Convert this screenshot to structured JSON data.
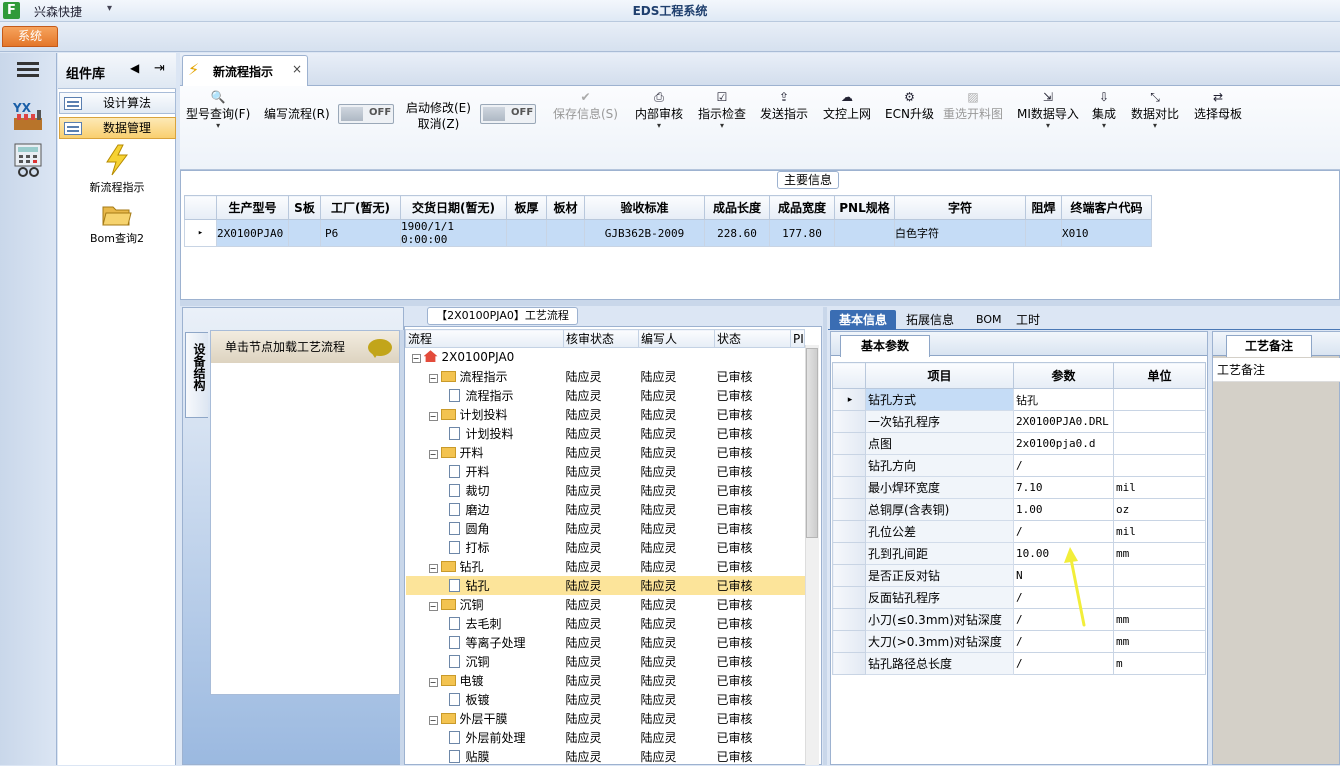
{
  "app": {
    "logo_letter": "F",
    "name": "兴森快捷",
    "qat_glyph": "▾",
    "window_title": "EDS工程系统",
    "menu_tab": "系统"
  },
  "component_library": {
    "title": "组件库",
    "prev_glyph": "◀",
    "pin_glyph": "⇥",
    "nav": [
      {
        "label": "设计算法"
      },
      {
        "label": "数据管理"
      }
    ],
    "tiles": [
      {
        "label": "新流程指示",
        "icon": "lightning-icon"
      },
      {
        "label": "Bom查询2",
        "icon": "folder-open-icon"
      }
    ]
  },
  "doc_tab": {
    "title": "新流程指示",
    "close": "×"
  },
  "toolbar": {
    "items": [
      {
        "label": "型号查询(F)",
        "icon": "🔍",
        "dropdown": "▾"
      },
      {
        "label": "编写流程(R)",
        "icon": "",
        "dropdown": ""
      },
      {
        "label": "启动修改(E)",
        "label2": "取消(Z)",
        "icon": "",
        "dropdown": ""
      },
      {
        "label": "保存信息(S)",
        "icon": "✔",
        "dropdown": ""
      },
      {
        "label": "内部审核",
        "icon": "⎙",
        "dropdown": "▾"
      },
      {
        "label": "指示检查",
        "icon": "☑",
        "dropdown": "▾"
      },
      {
        "label": "发送指示",
        "icon": "⇪",
        "dropdown": ""
      },
      {
        "label": "文控上网",
        "icon": "☁",
        "dropdown": ""
      },
      {
        "label": "ECN升级",
        "icon": "⚙",
        "dropdown": ""
      },
      {
        "label": "重选开料图",
        "icon": "▨",
        "dropdown": ""
      },
      {
        "label": "MI数据导入",
        "icon": "⇲",
        "dropdown": "▾"
      },
      {
        "label": "集成",
        "icon": "⇩",
        "dropdown": "▾"
      },
      {
        "label": "数据对比",
        "icon": "⤡",
        "dropdown": "▾"
      },
      {
        "label": "选择母板",
        "icon": "⇄",
        "dropdown": ""
      }
    ],
    "toggle1": "OFF",
    "toggle2": "OFF"
  },
  "main_info": {
    "title": "主要信息",
    "columns": [
      "生产型号",
      "S板",
      "工厂(暂无)",
      "交货日期(暂无)",
      "板厚",
      "板材",
      "验收标准",
      "成品长度",
      "成品宽度",
      "PNL规格",
      "字符",
      "阻焊",
      "终端客户代码"
    ],
    "row_marker": "▸",
    "rows": [
      [
        "2X0100PJA0",
        "",
        "P6",
        "1900/1/1 0:00:00",
        "",
        "",
        "GJB362B-2009",
        "228.60",
        "177.80",
        "",
        "白色字符",
        "",
        "X010"
      ]
    ]
  },
  "left_pane": {
    "vertical_tab": "设备结构",
    "load_text": "单击节点加载工艺流程"
  },
  "process_tree": {
    "title": "【2X0100PJA0】工艺流程",
    "columns": [
      "流程",
      "核审状态",
      "编写人",
      "状态",
      "PI"
    ],
    "expand_glyph": "−",
    "rows": [
      {
        "level": 0,
        "type": "root",
        "name": "2X0100PJA0",
        "c1": "",
        "c2": "",
        "c3": ""
      },
      {
        "level": 1,
        "type": "folder",
        "name": "流程指示",
        "c1": "陆应灵",
        "c2": "陆应灵",
        "c3": "已审核"
      },
      {
        "level": 2,
        "type": "file",
        "name": "流程指示",
        "c1": "陆应灵",
        "c2": "陆应灵",
        "c3": "已审核"
      },
      {
        "level": 1,
        "type": "folder",
        "name": "计划投料",
        "c1": "陆应灵",
        "c2": "陆应灵",
        "c3": "已审核"
      },
      {
        "level": 2,
        "type": "file",
        "name": "计划投料",
        "c1": "陆应灵",
        "c2": "陆应灵",
        "c3": "已审核"
      },
      {
        "level": 1,
        "type": "folder",
        "name": "开料",
        "c1": "陆应灵",
        "c2": "陆应灵",
        "c3": "已审核"
      },
      {
        "level": 2,
        "type": "file",
        "name": "开料",
        "c1": "陆应灵",
        "c2": "陆应灵",
        "c3": "已审核"
      },
      {
        "level": 2,
        "type": "file",
        "name": "裁切",
        "c1": "陆应灵",
        "c2": "陆应灵",
        "c3": "已审核"
      },
      {
        "level": 2,
        "type": "file",
        "name": "磨边",
        "c1": "陆应灵",
        "c2": "陆应灵",
        "c3": "已审核"
      },
      {
        "level": 2,
        "type": "file",
        "name": "圆角",
        "c1": "陆应灵",
        "c2": "陆应灵",
        "c3": "已审核"
      },
      {
        "level": 2,
        "type": "file",
        "name": "打标",
        "c1": "陆应灵",
        "c2": "陆应灵",
        "c3": "已审核"
      },
      {
        "level": 1,
        "type": "folder",
        "name": "钻孔",
        "c1": "陆应灵",
        "c2": "陆应灵",
        "c3": "已审核"
      },
      {
        "level": 2,
        "type": "file",
        "name": "钻孔",
        "c1": "陆应灵",
        "c2": "陆应灵",
        "c3": "已审核",
        "selected": true
      },
      {
        "level": 1,
        "type": "folder",
        "name": "沉铜",
        "c1": "陆应灵",
        "c2": "陆应灵",
        "c3": "已审核"
      },
      {
        "level": 2,
        "type": "file",
        "name": "去毛刺",
        "c1": "陆应灵",
        "c2": "陆应灵",
        "c3": "已审核"
      },
      {
        "level": 2,
        "type": "file",
        "name": "等离子处理",
        "c1": "陆应灵",
        "c2": "陆应灵",
        "c3": "已审核"
      },
      {
        "level": 2,
        "type": "file",
        "name": "沉铜",
        "c1": "陆应灵",
        "c2": "陆应灵",
        "c3": "已审核"
      },
      {
        "level": 1,
        "type": "folder",
        "name": "电镀",
        "c1": "陆应灵",
        "c2": "陆应灵",
        "c3": "已审核"
      },
      {
        "level": 2,
        "type": "file",
        "name": "板镀",
        "c1": "陆应灵",
        "c2": "陆应灵",
        "c3": "已审核"
      },
      {
        "level": 1,
        "type": "folder",
        "name": "外层干膜",
        "c1": "陆应灵",
        "c2": "陆应灵",
        "c3": "已审核"
      },
      {
        "level": 2,
        "type": "file",
        "name": "外层前处理",
        "c1": "陆应灵",
        "c2": "陆应灵",
        "c3": "已审核"
      },
      {
        "level": 2,
        "type": "file",
        "name": "贴膜",
        "c1": "陆应灵",
        "c2": "陆应灵",
        "c3": "已审核"
      }
    ]
  },
  "detail_tabs": [
    "基本信息",
    "拓展信息",
    "BOM",
    "工时"
  ],
  "base_params": {
    "tab": "基本参数",
    "columns": [
      "项目",
      "参数",
      "单位"
    ],
    "row_marker": "▸",
    "rows": [
      {
        "item": "钻孔方式",
        "value": "钻孔",
        "unit": ""
      },
      {
        "item": "一次钻孔程序",
        "value": "2X0100PJA0.DRL",
        "unit": ""
      },
      {
        "item": "点图",
        "value": "2x0100pja0.d",
        "unit": ""
      },
      {
        "item": "钻孔方向",
        "value": "/",
        "unit": ""
      },
      {
        "item": "最小焊环宽度",
        "value": "7.10",
        "unit": "mil"
      },
      {
        "item": "总铜厚(含表铜)",
        "value": "1.00",
        "unit": "oz"
      },
      {
        "item": "孔位公差",
        "value": "/",
        "unit": "mil"
      },
      {
        "item": "孔到孔间距",
        "value": "10.00",
        "unit": "mm"
      },
      {
        "item": "是否正反对钻",
        "value": "N",
        "unit": ""
      },
      {
        "item": "反面钻孔程序",
        "value": "/",
        "unit": ""
      },
      {
        "item": "小刀(≤0.3mm)对钻深度",
        "value": "/",
        "unit": "mm"
      },
      {
        "item": "大刀(>0.3mm)对钻深度",
        "value": "/",
        "unit": "mm"
      },
      {
        "item": "钻孔路径总长度",
        "value": "/",
        "unit": "m"
      }
    ]
  },
  "notes": {
    "tab": "工艺备注",
    "label": "工艺备注"
  },
  "colors": {
    "accent": "#3a6db3",
    "selection": "#fce49a",
    "arrow": "#f2ee3a"
  }
}
